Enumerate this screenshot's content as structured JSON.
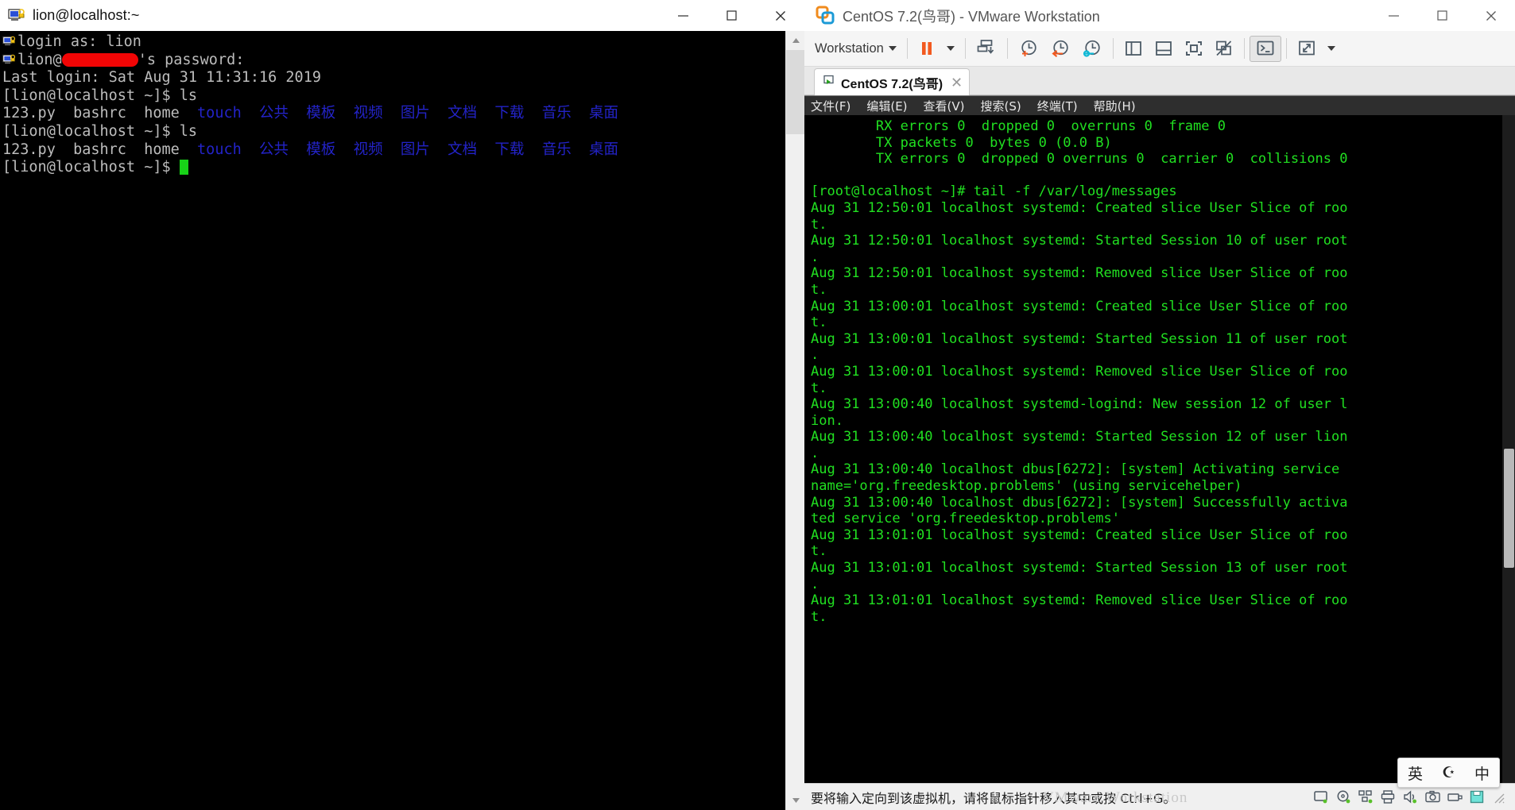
{
  "putty": {
    "title": "lion@localhost:~",
    "icon": "putty-ssh-icon",
    "window_buttons": {
      "minimize": "—",
      "maximize": "☐",
      "close": "✕"
    },
    "terminal": {
      "lines": [
        {
          "id": "l1",
          "icon": true,
          "segments": [
            {
              "text": "login as: lion",
              "color": "grey"
            }
          ]
        },
        {
          "id": "l2",
          "icon": true,
          "segments": [
            {
              "text": "lion@",
              "color": "grey"
            },
            {
              "text": "REDACTED",
              "color": "redact",
              "width": 96
            },
            {
              "text": "'s password:",
              "color": "grey"
            }
          ]
        },
        {
          "id": "l3",
          "icon": false,
          "segments": [
            {
              "text": "Last login: Sat Aug 31 11:31:16 2019",
              "color": "grey"
            }
          ]
        },
        {
          "id": "l4",
          "icon": false,
          "segments": [
            {
              "text": "[lion@localhost ~]$ ls",
              "color": "grey"
            }
          ]
        },
        {
          "id": "l5",
          "icon": false,
          "segments": [
            {
              "text": "123.py  bashrc  home  ",
              "color": "grey"
            },
            {
              "text": "touch",
              "color": "blue"
            },
            {
              "text": "  ",
              "color": "grey"
            },
            {
              "text": "公共  模板  视频  图片  文档  下载  音乐  桌面",
              "color": "blue"
            }
          ]
        },
        {
          "id": "l6",
          "icon": false,
          "segments": [
            {
              "text": "[lion@localhost ~]$ ls",
              "color": "grey"
            }
          ]
        },
        {
          "id": "l7",
          "icon": false,
          "segments": [
            {
              "text": "123.py  bashrc  home  ",
              "color": "grey"
            },
            {
              "text": "touch",
              "color": "blue"
            },
            {
              "text": "  ",
              "color": "grey"
            },
            {
              "text": "公共  模板  视频  图片  文档  下载  音乐  桌面",
              "color": "blue"
            }
          ]
        },
        {
          "id": "l8",
          "icon": false,
          "segments": [
            {
              "text": "[lion@localhost ~]$ ",
              "color": "grey"
            },
            {
              "text": "CURSOR",
              "color": "cursor"
            }
          ]
        }
      ],
      "bg_color": "#000000",
      "fg_color": "#bdbdbd",
      "dir_color": "#2323c8",
      "cursor_color": "#18d218"
    },
    "scrollbar": {
      "up_arrow": "▲",
      "down_arrow": "▼"
    }
  },
  "vmware": {
    "title": "CentOS 7.2(鸟哥) - VMware Workstation",
    "window_buttons": {
      "minimize": "—",
      "maximize": "☐",
      "close": "✕"
    },
    "toolbar": {
      "workstation_menu": "Workstation",
      "items": [
        {
          "name": "pause-vm-button",
          "icon": "pause-icon"
        },
        {
          "name": "pause-dropdown-button",
          "icon": "chevron-down-icon"
        },
        {
          "name": "send-ctrl-alt-del-button",
          "icon": "send-key-icon"
        },
        {
          "name": "take-snapshot-button",
          "icon": "snapshot-add-icon"
        },
        {
          "name": "revert-snapshot-button",
          "icon": "snapshot-revert-icon"
        },
        {
          "name": "manage-snapshots-button",
          "icon": "snapshot-manage-icon"
        },
        {
          "name": "show-left-pane-button",
          "icon": "panel-left-icon"
        },
        {
          "name": "show-bottom-pane-button",
          "icon": "panel-bottom-icon"
        },
        {
          "name": "fullscreen-button",
          "icon": "fullscreen-icon"
        },
        {
          "name": "unity-mode-button",
          "icon": "unity-off-icon"
        },
        {
          "name": "console-view-button",
          "icon": "console-icon"
        },
        {
          "name": "stretch-guest-button",
          "icon": "stretch-icon"
        },
        {
          "name": "stretch-dropdown-button",
          "icon": "chevron-down-icon"
        }
      ]
    },
    "tab": {
      "label": "CentOS 7.2(鸟哥)",
      "close": "✕",
      "icon": "vm-running-icon"
    },
    "guest": {
      "menubar": [
        {
          "label": "文件(F)",
          "name": "guest-menu-file"
        },
        {
          "label": "编辑(E)",
          "name": "guest-menu-edit"
        },
        {
          "label": "查看(V)",
          "name": "guest-menu-view"
        },
        {
          "label": "搜索(S)",
          "name": "guest-menu-search"
        },
        {
          "label": "终端(T)",
          "name": "guest-menu-terminal"
        },
        {
          "label": "帮助(H)",
          "name": "guest-menu-help"
        }
      ],
      "terminal_lines": [
        "        RX errors 0  dropped 0  overruns 0  frame 0",
        "        TX packets 0  bytes 0 (0.0 B)",
        "        TX errors 0  dropped 0 overruns 0  carrier 0  collisions 0",
        "",
        "[root@localhost ~]# tail -f /var/log/messages",
        "Aug 31 12:50:01 localhost systemd: Created slice User Slice of roo",
        "t.",
        "Aug 31 12:50:01 localhost systemd: Started Session 10 of user root",
        ".",
        "Aug 31 12:50:01 localhost systemd: Removed slice User Slice of roo",
        "t.",
        "Aug 31 13:00:01 localhost systemd: Created slice User Slice of roo",
        "t.",
        "Aug 31 13:00:01 localhost systemd: Started Session 11 of user root",
        ".",
        "Aug 31 13:00:01 localhost systemd: Removed slice User Slice of roo",
        "t.",
        "Aug 31 13:00:40 localhost systemd-logind: New session 12 of user l",
        "ion.",
        "Aug 31 13:00:40 localhost systemd: Started Session 12 of user lion",
        ".",
        "Aug 31 13:00:40 localhost dbus[6272]: [system] Activating service ",
        "name='org.freedesktop.problems' (using servicehelper)",
        "Aug 31 13:00:40 localhost dbus[6272]: [system] Successfully activa",
        "ted service 'org.freedesktop.problems'",
        "Aug 31 13:01:01 localhost systemd: Created slice User Slice of roo",
        "t.",
        "Aug 31 13:01:01 localhost systemd: Started Session 13 of user root",
        ".",
        "Aug 31 13:01:01 localhost systemd: Removed slice User Slice of roo",
        "t."
      ],
      "fg_color": "#21e021",
      "bg_color": "#000000"
    },
    "statusbar": {
      "message": "要将输入定向到该虚拟机，请将鼠标指针移入其中或按 Ctrl+G。",
      "icons": [
        {
          "name": "status-hard-disk-icon"
        },
        {
          "name": "status-cd-dvd-icon"
        },
        {
          "name": "status-network-icon"
        },
        {
          "name": "status-printer-icon"
        },
        {
          "name": "status-sound-icon"
        },
        {
          "name": "status-camera-icon"
        },
        {
          "name": "status-usb-icon"
        },
        {
          "name": "status-floppy-icon"
        }
      ]
    }
  },
  "ime": {
    "items": [
      {
        "label": "英",
        "name": "ime-language-toggle"
      },
      {
        "label": "☪",
        "name": "ime-moon-icon"
      },
      {
        "label": "中",
        "name": "ime-shape-icon"
      }
    ]
  }
}
